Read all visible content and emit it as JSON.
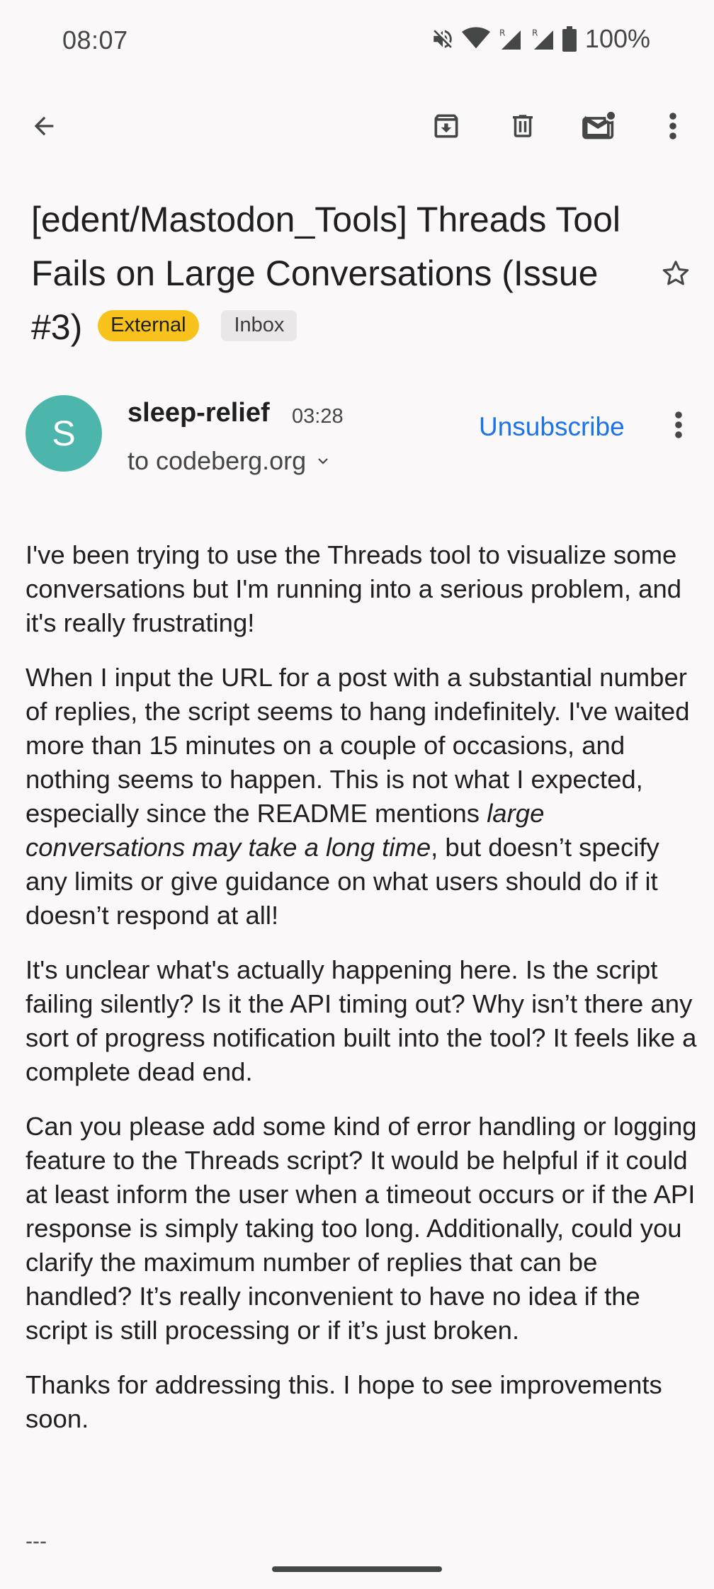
{
  "status_bar": {
    "time": "08:07",
    "battery": "100%",
    "icons": [
      "mute-icon",
      "wifi-icon",
      "signal-r-icon",
      "signal-r-icon",
      "battery-icon"
    ]
  },
  "action_bar": {
    "icons": [
      "back-arrow-icon",
      "archive-icon",
      "delete-icon",
      "mark-unread-icon",
      "more-vert-icon"
    ]
  },
  "email": {
    "subject": "[edent/Mastodon_Tools] Threads Tool Fails on Large Conversations (Issue #3)",
    "chips": {
      "external": "External",
      "inbox": "Inbox"
    },
    "external_chip_color": "#f8c21d",
    "sender": {
      "avatar_letter": "S",
      "avatar_color": "#4db6ac",
      "name": "sleep-relief",
      "time": "03:28",
      "recipient": "to codeberg.org",
      "unsubscribe": "Unsubscribe"
    },
    "body": {
      "p1": "I've been trying to use the Threads tool to visualize some conversations but I'm running into a serious problem, and it's really frustrating!",
      "p2_before": "When I input the URL for a post with a substantial number of replies, the script seems to hang indefinitely. I've waited more than 15 minutes on a couple of occasions, and nothing seems to happen. This is not what I expected, especially since the README mentions ",
      "p2_italic": "large conversations may take a long time",
      "p2_after": ", but doesn’t specify any limits or give guidance on what users should do if it doesn’t respond at all!",
      "p3": "It's unclear what's actually happening here. Is the script failing silently? Is it the API timing out? Why isn’t there any sort of progress notification built into the tool? It feels like a complete dead end.",
      "p4": "Can you please add some kind of error handling or logging feature to the Threads script? It would be helpful if it could at least inform the user when a timeout occurs or if the API response is simply taking too long. Additionally, could you clarify the maximum number of replies that can be handled? It’s really inconvenient to have no idea if the script is still processing or if it’s just broken.",
      "p5": "Thanks for addressing this. I hope to see improvements soon.",
      "signature_separator": "---"
    }
  }
}
